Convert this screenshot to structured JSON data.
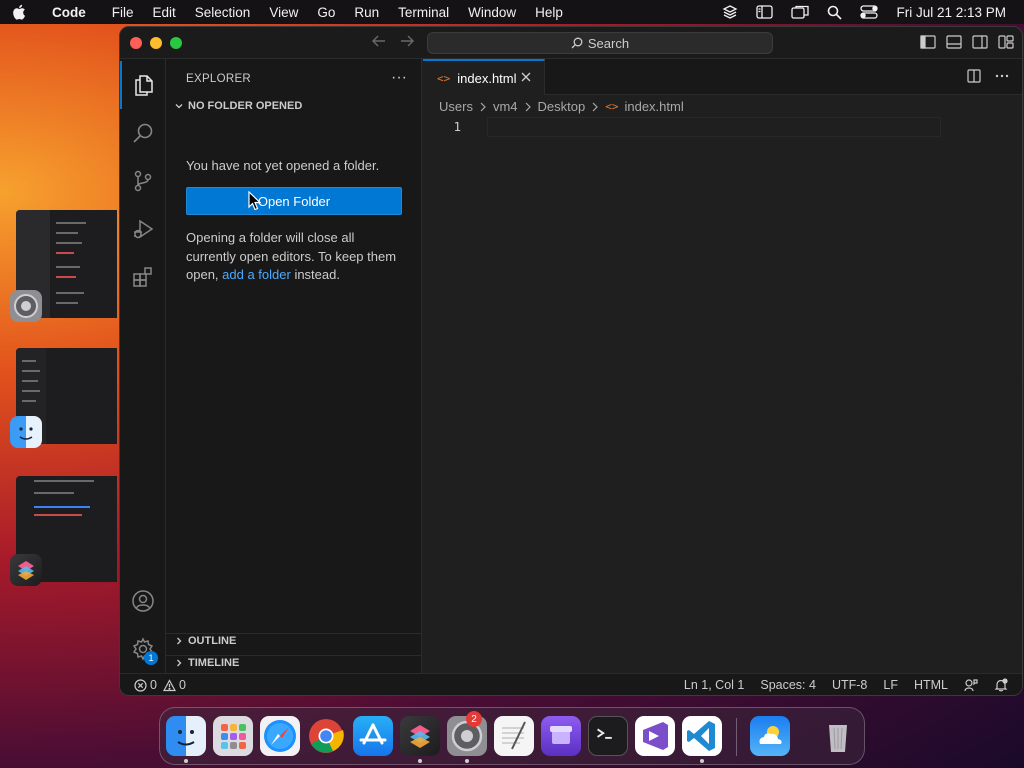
{
  "menubar": {
    "app_name": "Code",
    "items": [
      "File",
      "Edit",
      "Selection",
      "View",
      "Go",
      "Run",
      "Terminal",
      "Window",
      "Help"
    ],
    "clock": "Fri Jul 21  2:13 PM"
  },
  "titlebar": {
    "search_label": "Search"
  },
  "sidebar": {
    "header": "EXPLORER",
    "section_title": "NO FOLDER OPENED",
    "message": "You have not yet opened a folder.",
    "open_folder_label": "Open Folder",
    "info_before_link": "Opening a folder will close all currently open editors. To keep them open, ",
    "info_link": "add a folder",
    "info_after_link": " instead.",
    "outline_label": "OUTLINE",
    "timeline_label": "TIMELINE"
  },
  "activitybar": {
    "items": [
      "explorer-icon",
      "search-icon",
      "source-control-icon",
      "run-debug-icon",
      "extensions-icon"
    ],
    "bottom": [
      "account-icon",
      "manage-gear-icon"
    ],
    "manage_badge": "1"
  },
  "editor": {
    "tab_label": "index.html",
    "breadcrumb": [
      "Users",
      "vm4",
      "Desktop",
      "index.html"
    ],
    "line_number": "1"
  },
  "statusbar": {
    "errors": "0",
    "warnings": "0",
    "position": "Ln 1, Col 1",
    "spaces": "Spaces: 4",
    "encoding": "UTF-8",
    "eol": "LF",
    "language": "HTML"
  },
  "dock": {
    "apps": [
      "Finder",
      "Launchpad",
      "Safari",
      "Google Chrome",
      "App Store",
      "Shortcuts",
      "System Settings",
      "TextEdit",
      "Archive Utility",
      "Terminal",
      "Visual Studio",
      "Visual Studio Code",
      "Weather",
      "Trash"
    ],
    "settings_badge": "2"
  },
  "colors": {
    "accent": "#0078d4",
    "link": "#4daafc",
    "html_icon": "#e37933"
  }
}
